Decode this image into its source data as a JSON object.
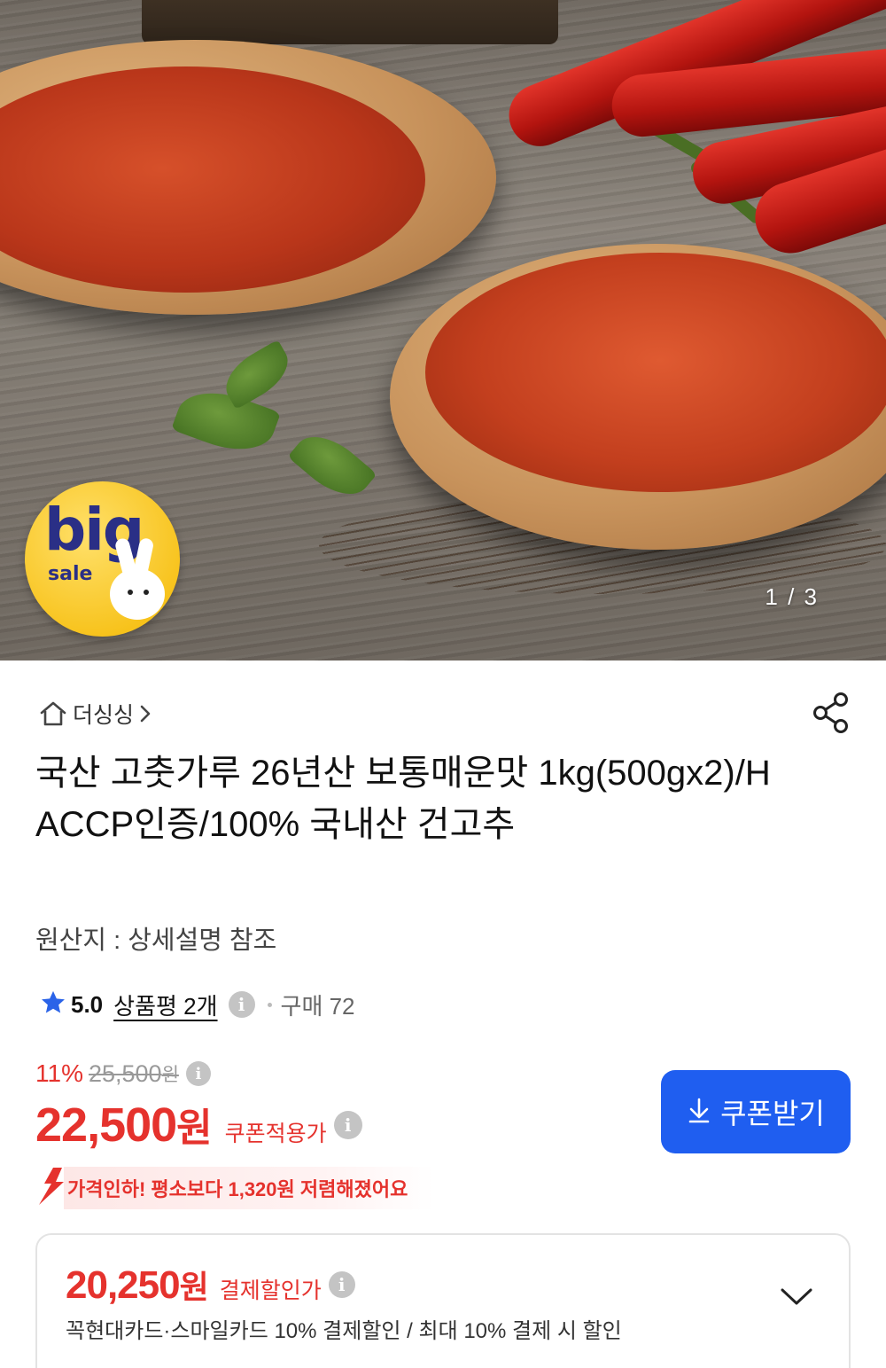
{
  "hero": {
    "image_counter": "1 / 3",
    "badge": {
      "line1": "big",
      "line2": "sale"
    }
  },
  "store": {
    "name": "더싱싱"
  },
  "product": {
    "title": "국산 고춧가루 26년산 보통매운맛 1kg(500gx2)/HACCP인증/100% 국내산 건고추",
    "origin": "원산지 : 상세설명 참조"
  },
  "rating": {
    "score": "5.0",
    "review_label": "상품평 2개",
    "purchase_label": "구매 72"
  },
  "price": {
    "discount_rate": "11%",
    "original_price": "25,500",
    "original_unit": "원",
    "sale_price": "22,500",
    "sale_unit": "원",
    "sale_label": "쿠폰적용가",
    "coupon_button": "쿠폰받기",
    "price_drop_notice": "가격인하! 평소보다 1,320원 저렴해졌어요"
  },
  "payment": {
    "price": "20,250",
    "unit": "원",
    "label": "결제할인가",
    "description": "꼭현대카드·스마일카드 10% 결제할인 / 최대 10% 결제 시 할인"
  },
  "colors": {
    "accent_red": "#e5322d",
    "coupon_blue": "#1f5ef0",
    "star_blue": "#2a63e8",
    "badge_yellow": "#f7c21a"
  }
}
